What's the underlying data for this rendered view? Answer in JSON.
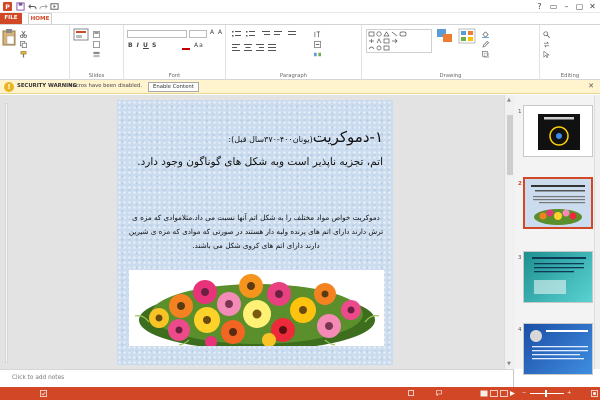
{
  "window": {
    "title": ""
  },
  "tabs": [
    {
      "label": "FILE"
    },
    {
      "label": "HOME"
    },
    {
      "label": ""
    },
    {
      "label": ""
    },
    {
      "label": ""
    },
    {
      "label": ""
    },
    {
      "label": ""
    },
    {
      "label": ""
    }
  ],
  "ribbon": {
    "clipboard": {
      "paste": "",
      "cut": "",
      "copy": "",
      "format_painter": "",
      "label": ""
    },
    "slides": {
      "new_slide": "",
      "layout": "",
      "reset": "",
      "section": "",
      "label": "Slides"
    },
    "font": {
      "label": "Font"
    },
    "paragraph": {
      "text_direction": "",
      "align_text": "",
      "convert_smartart": "",
      "label": "Paragraph"
    },
    "drawing": {
      "arrange": "",
      "quick_styles": "",
      "shape_fill": "",
      "shape_outline": "",
      "shape_effects": "",
      "label": "Drawing"
    },
    "editing": {
      "find": "",
      "replace": "",
      "select": "",
      "label": "Editing"
    }
  },
  "security_bar": {
    "title": "SECURITY WARNING",
    "message": "Macros have been disabled.",
    "button": "Enable Content"
  },
  "slide": {
    "heading_main": "۱-دموکریت",
    "heading_paren": "(یونان۴۰۰-۳۷۰سال قبل):",
    "subheading": "اتم، تجزیه ناپذیر است وبه شکل های گوناگون وجود دارد.",
    "body": "دموکریت خواص مواد مختلف را به شکل اتم آنها نسبت می داد.مثلاموادی که مزه ی ترش دارند دارای اتم های پرنده ولبه دار هستند در صورتی که موادی که مزه ی شیرین دارند دارای اتم های کروی شکل می باشند."
  },
  "thumbnails": [
    {
      "num": "1",
      "selected": false
    },
    {
      "num": "2",
      "selected": true
    },
    {
      "num": "3",
      "selected": false
    },
    {
      "num": "4",
      "selected": false
    }
  ],
  "notes": {
    "placeholder": "Click to add notes"
  },
  "status": {
    "slide_info": "",
    "language": "",
    "notes_btn": "",
    "comments_btn": "",
    "zoom": ""
  },
  "colors": {
    "accent": "#d24726",
    "slide_bg": "#cbdcef",
    "warning_bg": "#fff4ce"
  }
}
